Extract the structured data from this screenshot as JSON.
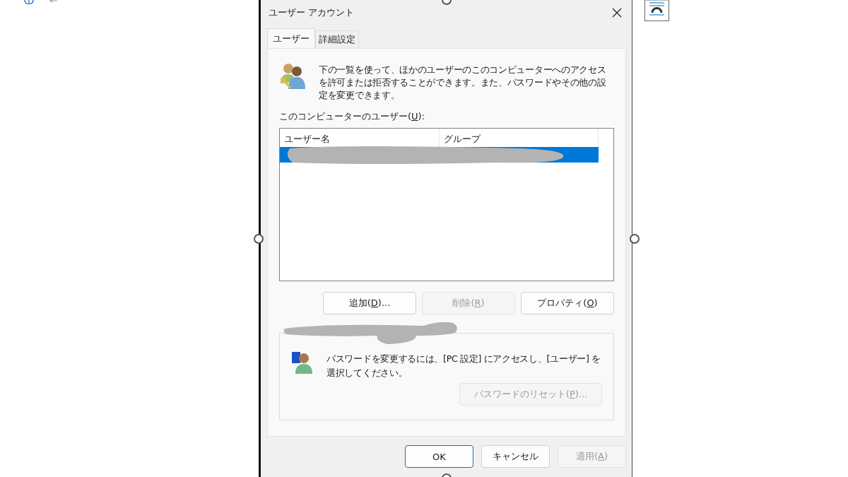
{
  "window": {
    "title": "ユーザー アカウント"
  },
  "tabs": [
    {
      "label": "ユーザー",
      "selected": true
    },
    {
      "label": "詳細設定",
      "selected": false
    }
  ],
  "intro": "下の一覧を使って、ほかのユーザーのこのコンピューターへのアクセスを許可または拒否することができます。また、パスワードやその他の設定を変更できます。",
  "users_label": {
    "before": "このコンピューターのユーザー(",
    "key": "U",
    "after": "):"
  },
  "table": {
    "columns": [
      "ユーザー名",
      "グループ"
    ],
    "rows": [
      {
        "selected": true
      }
    ]
  },
  "list_buttons": [
    {
      "before": "追加(",
      "key": "D",
      "after": ")...",
      "disabled": false
    },
    {
      "before": "削除(",
      "key": "R",
      "after": ")",
      "disabled": true
    },
    {
      "before": "プロパティ(",
      "key": "O",
      "after": ")",
      "disabled": false
    }
  ],
  "password_box": {
    "text": "パスワードを変更するには、[PC 設定] にアクセスし、[ユーザー] を選択してください。",
    "reset_button": {
      "before": "パスワードのリセット(",
      "key": "P",
      "after": ")...",
      "disabled": true
    }
  },
  "footer_buttons": [
    {
      "before": "OK",
      "disabled": false,
      "default": true
    },
    {
      "before": "キャンセル",
      "disabled": false,
      "default": false
    },
    {
      "before": "適用(",
      "key": "A",
      "after": ")",
      "disabled": true,
      "default": false
    }
  ]
}
